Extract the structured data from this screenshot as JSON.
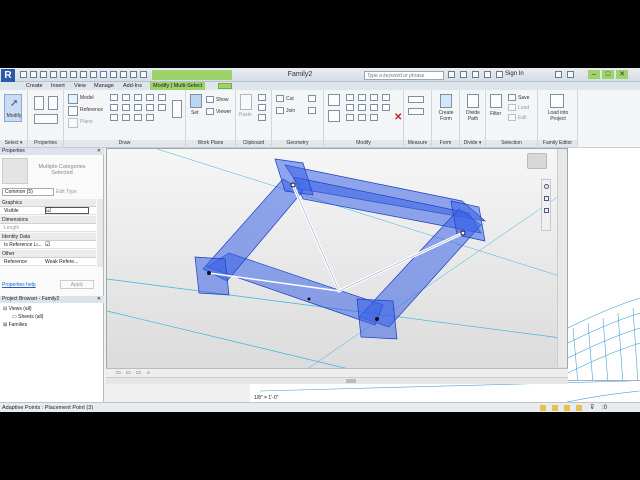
{
  "app": {
    "doc_title": "Family2",
    "search_placeholder": "Type a keyword or phrase",
    "sign_in": "Sign In"
  },
  "tabs": [
    "Create",
    "Insert",
    "View",
    "Manage",
    "Add-Ins",
    "Modify | Multi-Select"
  ],
  "active_tab_index": 5,
  "ribbon": {
    "select": {
      "label": "Select ▾",
      "modify": "Modify"
    },
    "properties": {
      "label": "Properties"
    },
    "draw": {
      "label": "Draw",
      "model": "Model",
      "reference": "Reference",
      "plane": "Plane"
    },
    "work_plane": {
      "label": "Work Plane",
      "set": "Set",
      "show": "Show",
      "viewer": "Viewer"
    },
    "clipboard": {
      "label": "Clipboard",
      "paste": "Paste"
    },
    "geometry": {
      "label": "Geometry",
      "cut": "Cut",
      "join": "Join"
    },
    "modify": {
      "label": "Modify"
    },
    "measure": {
      "label": "Measure"
    },
    "form": {
      "label": "Form",
      "create_form": "Create Form"
    },
    "divide": {
      "label": "Divide ▾",
      "divide_path": "Divide Path"
    },
    "selection": {
      "label": "Selection",
      "filter": "Filter",
      "save": "Save",
      "load": "Load",
      "edit": "Edit"
    },
    "family_editor": {
      "label": "Family Editor",
      "load_into_project": "Load into Project"
    }
  },
  "properties_palette": {
    "title": "Properties",
    "type_name": "Multiple Categories Selected",
    "filter_value": "Common (5)",
    "edit_type": "Edit Type",
    "groups": [
      {
        "name": "Graphics",
        "rows": [
          {
            "label": "Visible",
            "value": "☑"
          }
        ]
      },
      {
        "name": "Dimensions",
        "rows": [
          {
            "label": "Length",
            "value": ""
          }
        ]
      },
      {
        "name": "Identity Data",
        "rows": [
          {
            "label": "Is Reference Li...",
            "value": "☑"
          }
        ]
      },
      {
        "name": "Other",
        "rows": [
          {
            "label": "Reference",
            "value": "Weak Refere..."
          }
        ]
      }
    ],
    "help_link": "Properties help",
    "apply": "Apply"
  },
  "project_browser": {
    "title": "Project Browser - Family2",
    "items": [
      "Views (all)",
      "Sheets (all)",
      "Families"
    ]
  },
  "view_bar": {
    "scale": "1/8\" = 1'-0\""
  },
  "status": {
    "text": "Adaptive Points : Placement Point (3)"
  },
  "colors": {
    "ribbon_active_tab": "#9ed36a",
    "selection_blue": "#3b63e6",
    "background": "#000000"
  }
}
